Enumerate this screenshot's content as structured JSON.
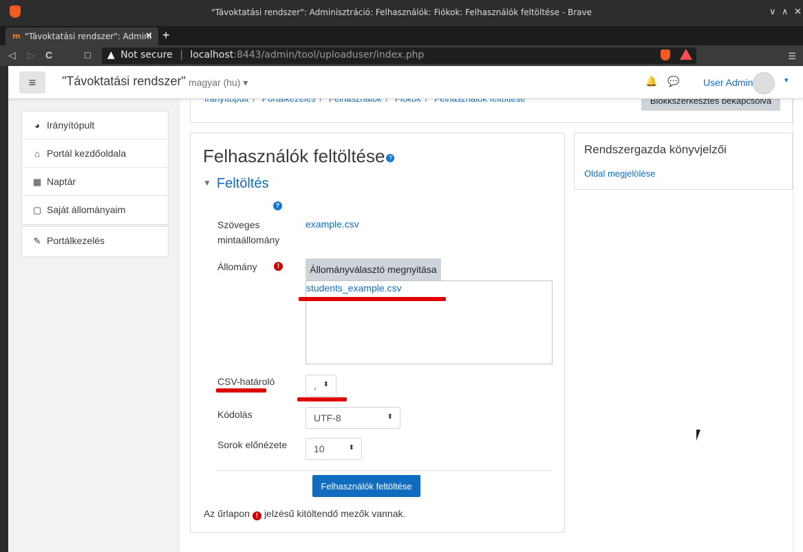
{
  "window": {
    "title": "\"Távoktatási rendszer\": Adminisztráció: Felhasználók: Fiókok: Felhasználók feltöltése - Brave",
    "controls": [
      "∨",
      "∧",
      "✕"
    ]
  },
  "tab": {
    "favicon": "m",
    "title": "\"Távoktatási rendszer\": Admini",
    "close": "✕",
    "new_tab": "+"
  },
  "urlbar": {
    "back": "◁",
    "forward": "▷",
    "reload": "C",
    "bookmark": "☐",
    "warning": "▲",
    "security": "Not secure",
    "host": "localhost",
    "port_path": ":8443/admin/tool/uploaduser/index.php",
    "menu": "☰"
  },
  "navbar": {
    "menu_glyph": "≡",
    "site_name": "\"Távoktatási rendszer\"",
    "language": "magyar (hu) ▾",
    "bell": "🔔",
    "chat": "💬",
    "user": "User Admin",
    "user_caret": "▾"
  },
  "breadcrumb": {
    "items": [
      "Irányítópult",
      "Portálkezelés",
      "Felhasználók",
      "Fiókok",
      "Felhasználók feltöltése"
    ],
    "separator": "/",
    "block_button": "Blokkszerkesztés bekapcsolva"
  },
  "sidebar": {
    "items": [
      {
        "label": "Irányítópult",
        "icon": "dashboard-icon",
        "glyph": "◕"
      },
      {
        "label": "Portál kezdőoldala",
        "icon": "home-icon",
        "glyph": "⌂"
      },
      {
        "label": "Naptár",
        "icon": "calendar-icon",
        "glyph": "▦"
      },
      {
        "label": "Saját állományaim",
        "icon": "file-icon",
        "glyph": "▢"
      }
    ],
    "admin_item": {
      "label": "Portálkezelés",
      "icon": "wrench-icon",
      "glyph": "✎"
    }
  },
  "form": {
    "heading": "Felhasználók feltöltése",
    "heading_help": "?",
    "section": "Feltöltés",
    "section_toggle": "▼",
    "help": "?",
    "sample_label": "Szöveges mintaállomány",
    "sample_link": "example.csv",
    "file_label": "Állomány",
    "required_glyph": "!",
    "file_picker_button": "Állományválasztó megnyitása",
    "selected_file": "students_example.csv",
    "delimiter_label": "CSV-határoló",
    "delimiter_value": ",",
    "encoding_label": "Kódolás",
    "encoding_value": "UTF-8",
    "preview_label": "Sorok előnézete",
    "preview_value": "10",
    "select_arrow": "⬍",
    "submit": "Felhasználók feltöltése",
    "footnote_before": "Az űrlapon",
    "footnote_after": "jelzésű kitöltendő mezők vannak."
  },
  "admin_bookmarks": {
    "title": "Rendszergazda könyvjelzői",
    "link": "Oldal megjelölése"
  },
  "colors": {
    "link": "#0f6cbf",
    "required": "#cc0000",
    "annotation": "#e00000",
    "button_primary": "#0f6cbf"
  }
}
